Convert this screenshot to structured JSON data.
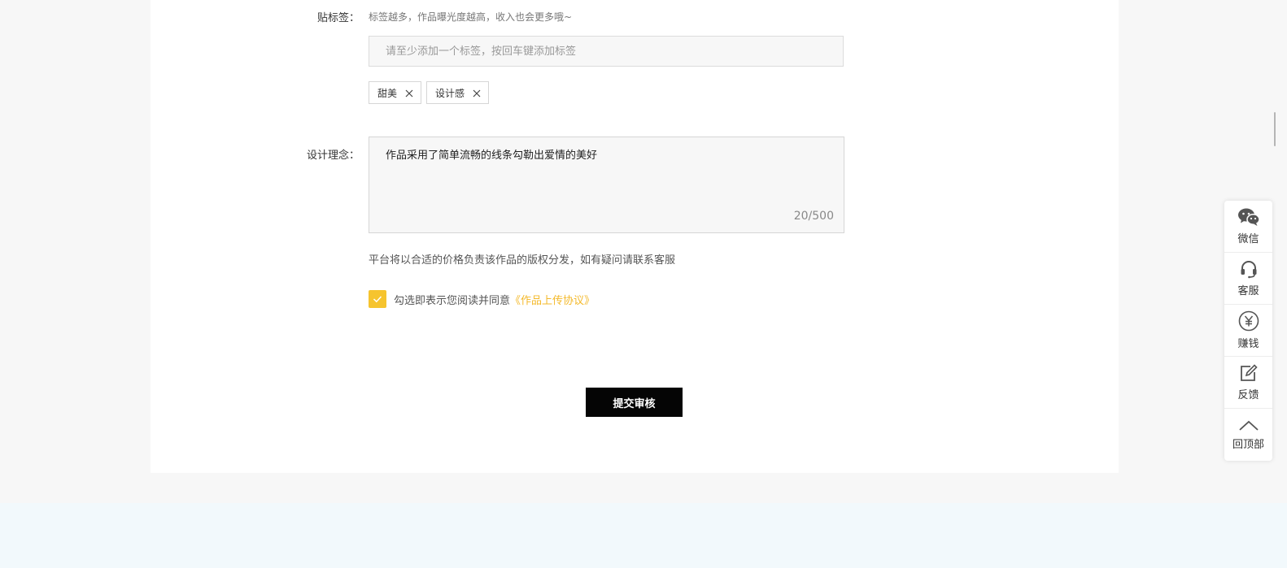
{
  "form": {
    "tags": {
      "label": "贴标签：",
      "hint": "标签越多，作品曝光度越高，收入也会更多哦~",
      "input_placeholder": "请至少添加一个标签，按回车键添加标签",
      "items": [
        "甜美",
        "设计感"
      ]
    },
    "design": {
      "label": "设计理念：",
      "value": "作品采用了简单流畅的线条勾勒出爱情的美好",
      "counter": "20/500"
    },
    "notice": "平台将以合适的价格负责该作品的版权分发，如有疑问请联系客服",
    "agreement": {
      "checked": true,
      "text": "勾选即表示您阅读并同意",
      "link": "《作品上传协议》"
    },
    "submit_label": "提交审核"
  },
  "sidebar": {
    "items": [
      {
        "icon": "wechat-icon",
        "label": "微信"
      },
      {
        "icon": "headset-icon",
        "label": "客服"
      },
      {
        "icon": "yuan-icon",
        "label": "赚钱"
      },
      {
        "icon": "edit-icon",
        "label": "反馈"
      },
      {
        "icon": "chevron-up-icon",
        "label": "回顶部"
      }
    ]
  },
  "colors": {
    "accent": "#f6c42e",
    "link": "#f4b92a",
    "submit_bg": "#050505"
  }
}
